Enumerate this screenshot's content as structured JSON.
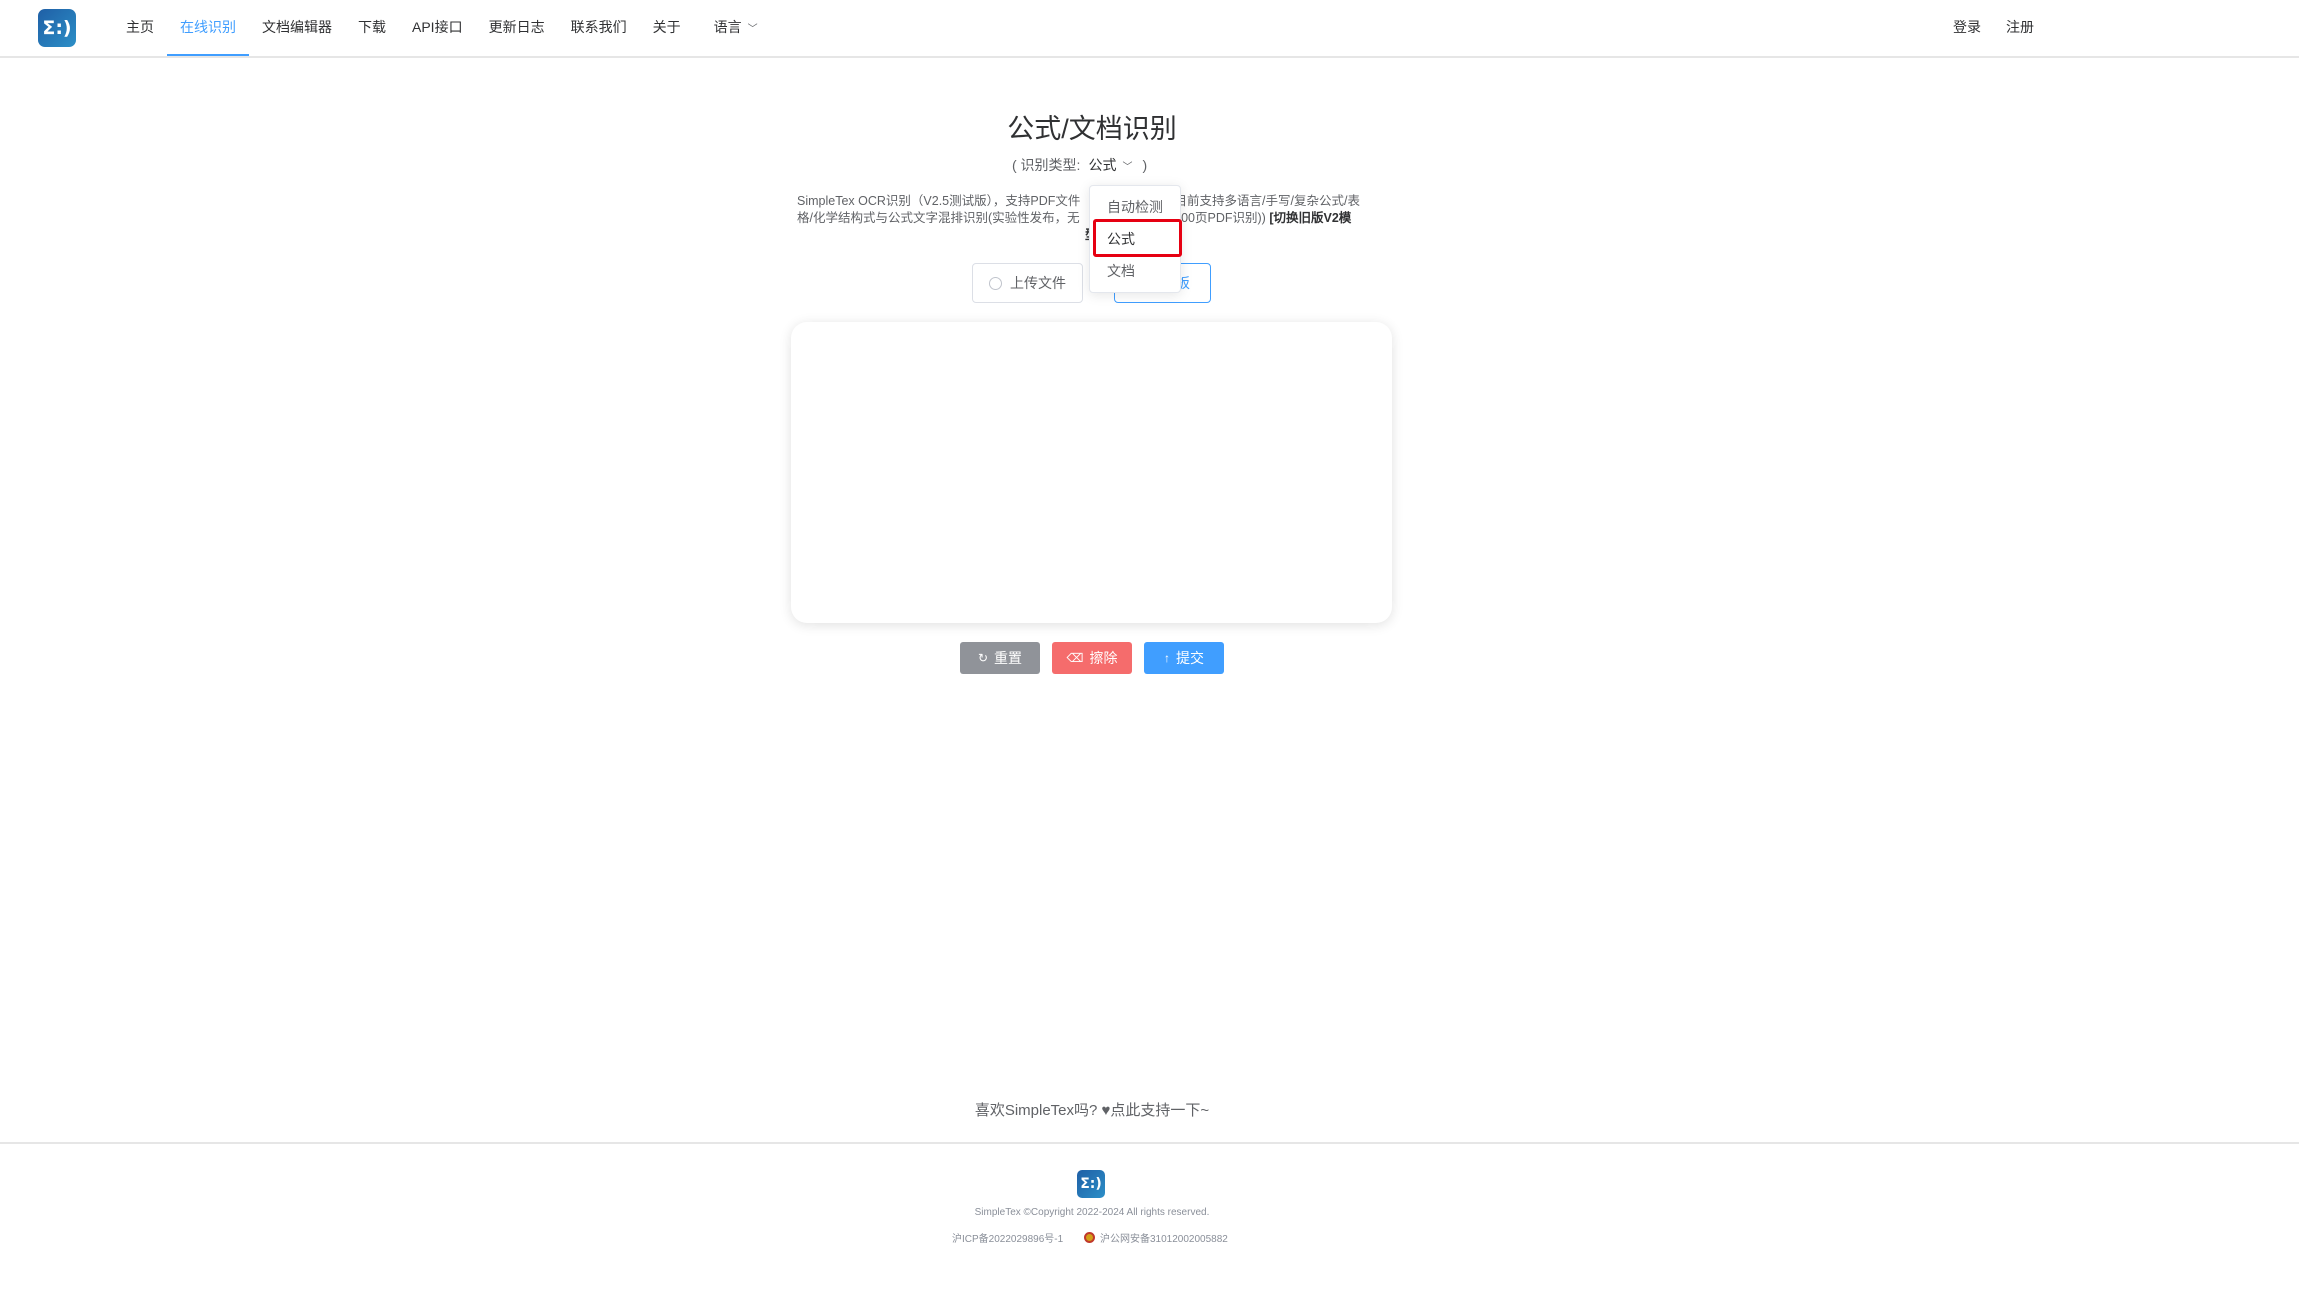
{
  "header": {
    "logo_text": "Σ:)",
    "nav": [
      {
        "label": "主页",
        "active": false
      },
      {
        "label": "在线识别",
        "active": true
      },
      {
        "label": "文档编辑器",
        "active": false
      },
      {
        "label": "下载",
        "active": false
      },
      {
        "label": "API接口",
        "active": false
      },
      {
        "label": "更新日志",
        "active": false
      },
      {
        "label": "联系我们",
        "active": false
      },
      {
        "label": "关于",
        "active": false
      }
    ],
    "language_label": "语言",
    "login_label": "登录",
    "register_label": "注册"
  },
  "main": {
    "title": "公式/文档识别",
    "type_prefix": "( 识别类型:",
    "type_value": "公式",
    "type_suffix": ")",
    "description_line1": "SimpleTex OCR识别（V2.5测试版），支持PDF文件",
    "description_line1b": "(目前支持多语言/手写/复杂公式/表",
    "description_line2": "格/化学结构式与公式文字混排识别(实验性发布，无",
    "description_line2b": "次200页PDF识别))",
    "switch_link": "[切换旧版V2模",
    "description_line3": "型",
    "upload_label": "上传文件",
    "board_label_partial": "板"
  },
  "dropdown": {
    "items": [
      "自动检测",
      "公式",
      "文档"
    ],
    "selected": "公式"
  },
  "actions": {
    "reset_label": "重置",
    "erase_label": "擦除",
    "submit_label": "提交"
  },
  "footer": {
    "support_text": "喜欢SimpleTex吗? ♥点此支持一下~",
    "copyright": "SimpleTex ©Copyright 2022-2024 All rights reserved.",
    "icp": "沪ICP备2022029896号-1",
    "police": "沪公网安备31012002005882"
  },
  "colors": {
    "primary": "#409eff",
    "danger": "#f56c6c",
    "info": "#909399",
    "highlight": "#e60012"
  }
}
